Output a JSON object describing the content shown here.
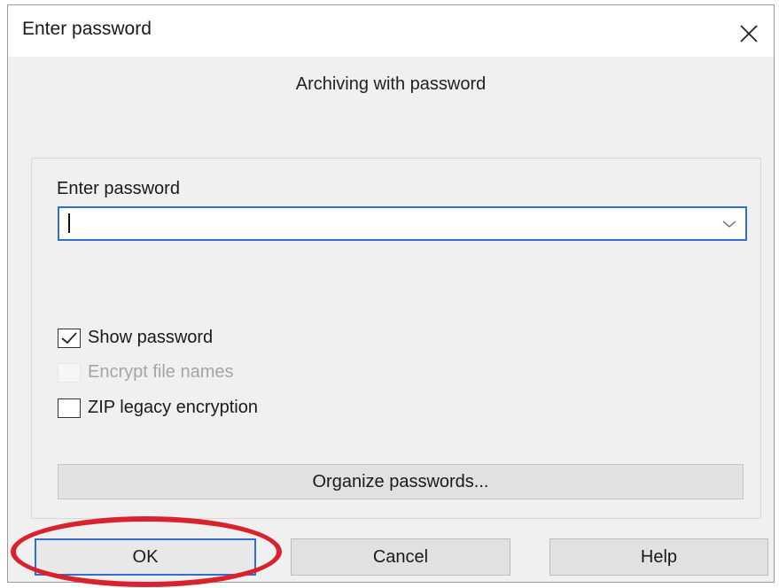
{
  "dialog": {
    "title": "Enter password",
    "heading": "Archiving with password"
  },
  "password": {
    "label": "Enter password",
    "value": ""
  },
  "options": {
    "show_password": {
      "label": "Show password",
      "checked": true,
      "enabled": true
    },
    "encrypt_file_names": {
      "label": "Encrypt file names",
      "checked": false,
      "enabled": false
    },
    "zip_legacy": {
      "label": "ZIP legacy encryption",
      "checked": false,
      "enabled": true
    }
  },
  "buttons": {
    "organize": "Organize passwords...",
    "ok": "OK",
    "cancel": "Cancel",
    "help": "Help"
  },
  "colors": {
    "focus_blue": "#2f6fd0",
    "annotation_red": "#d8222d",
    "dialog_bg": "#f0f0f0"
  },
  "icons": {
    "close": "close-x-icon",
    "dropdown": "chevron-down-icon",
    "check": "checkmark-icon"
  }
}
